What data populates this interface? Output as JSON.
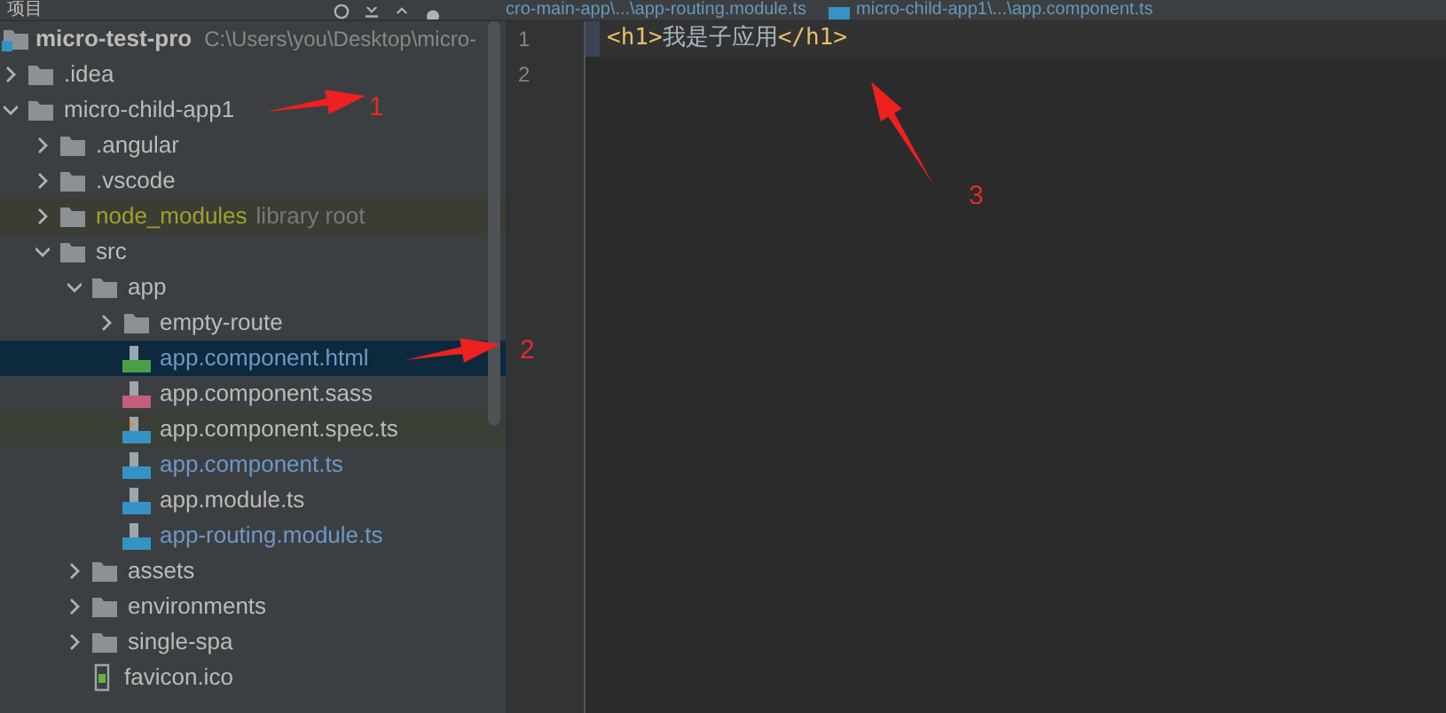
{
  "top_bar": {
    "panel_title": "项目",
    "tabs": [
      {
        "label": "cro-main-app\\...\\app-routing.module.ts"
      },
      {
        "label": "micro-child-app1\\...\\app.component.ts"
      }
    ]
  },
  "project_tree": {
    "root": {
      "name": "micro-test-pro",
      "path": "C:\\Users\\you\\Desktop\\micro-",
      "children": [
        {
          "name": ".idea",
          "kind": "folder",
          "expanded": false,
          "selected": false
        },
        {
          "name": "micro-child-app1",
          "kind": "folder",
          "expanded": true,
          "selected": false,
          "children": [
            {
              "name": ".angular",
              "kind": "folder",
              "expanded": false,
              "selected": false
            },
            {
              "name": ".vscode",
              "kind": "folder",
              "expanded": false,
              "selected": false
            },
            {
              "name": "node_modules",
              "kind": "library",
              "note": "library root",
              "expanded": false,
              "selected": false
            },
            {
              "name": "src",
              "kind": "folder",
              "expanded": true,
              "selected": false,
              "children": [
                {
                  "name": "app",
                  "kind": "folder",
                  "expanded": true,
                  "selected": false,
                  "children": [
                    {
                      "name": "empty-route",
                      "kind": "folder",
                      "expanded": false,
                      "selected": false
                    },
                    {
                      "name": "app.component.html",
                      "kind": "html",
                      "modified": true,
                      "selected": true
                    },
                    {
                      "name": "app.component.sass",
                      "kind": "sass",
                      "modified": false,
                      "selected": false
                    },
                    {
                      "name": "app.component.spec.ts",
                      "kind": "spec",
                      "modified": false,
                      "selected": false
                    },
                    {
                      "name": "app.component.ts",
                      "kind": "ts",
                      "modified": true,
                      "selected": false
                    },
                    {
                      "name": "app.module.ts",
                      "kind": "ts",
                      "modified": false,
                      "selected": false
                    },
                    {
                      "name": "app-routing.module.ts",
                      "kind": "ts",
                      "modified": true,
                      "selected": false
                    }
                  ]
                },
                {
                  "name": "assets",
                  "kind": "folder",
                  "expanded": false,
                  "selected": false
                },
                {
                  "name": "environments",
                  "kind": "folder",
                  "expanded": false,
                  "selected": false
                },
                {
                  "name": "single-spa",
                  "kind": "folder",
                  "expanded": false,
                  "selected": false
                },
                {
                  "name": "favicon.ico",
                  "kind": "ico",
                  "modified": false,
                  "selected": false
                }
              ]
            }
          ]
        }
      ]
    }
  },
  "editor": {
    "lines": [
      {
        "number": "1",
        "current": true,
        "tokens": [
          {
            "kind": "tag",
            "text": "<h1>"
          },
          {
            "kind": "text",
            "text": "我是子应用"
          },
          {
            "kind": "tag",
            "text": "</h1>"
          }
        ]
      },
      {
        "number": "2"
      }
    ]
  },
  "annotations": [
    {
      "label": "1"
    },
    {
      "label": "2"
    },
    {
      "label": "3"
    }
  ]
}
